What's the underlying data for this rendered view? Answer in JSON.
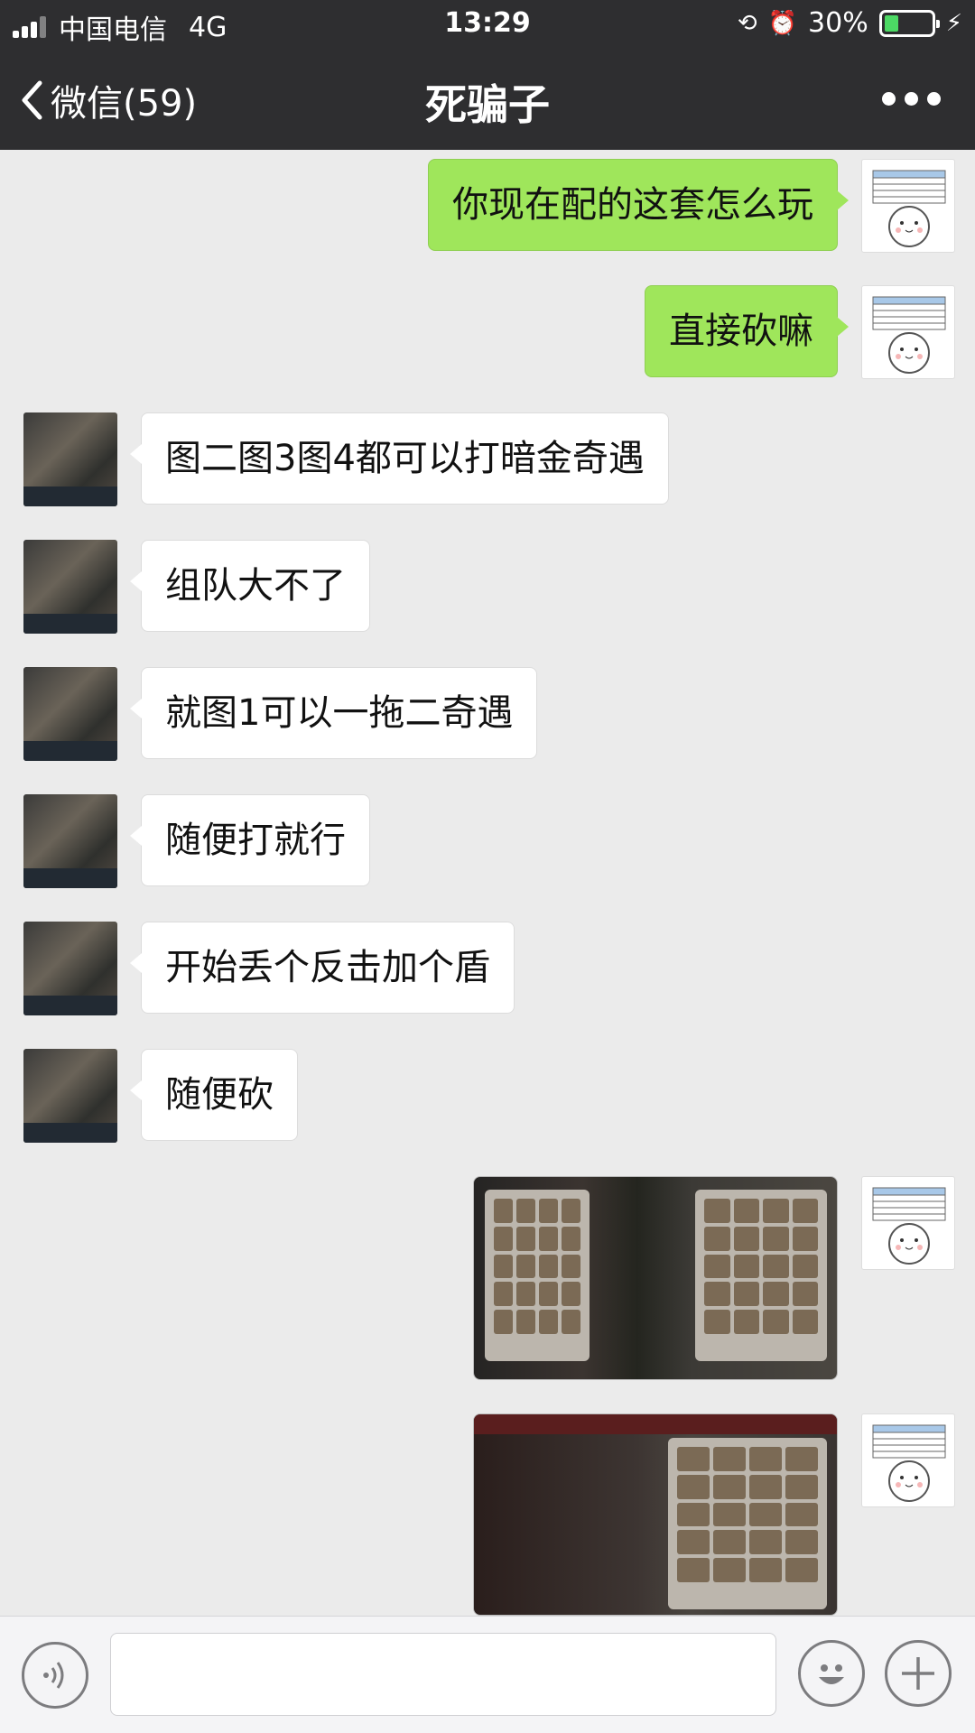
{
  "status_bar": {
    "carrier": "中国电信",
    "network": "4G",
    "time": "13:29",
    "battery_percent": "30%",
    "battery_level": 0.3
  },
  "nav": {
    "back_label": "微信(59)",
    "title": "死骗子"
  },
  "messages": [
    {
      "side": "out",
      "text": "你现在配的这套怎么玩"
    },
    {
      "side": "out",
      "text": "直接砍嘛"
    },
    {
      "side": "in",
      "text": "图二图3图4都可以打暗金奇遇"
    },
    {
      "side": "in",
      "text": "组队大不了"
    },
    {
      "side": "in",
      "text": "就图1可以一拖二奇遇"
    },
    {
      "side": "in",
      "text": "随便打就行"
    },
    {
      "side": "in",
      "text": "开始丢个反击加个盾"
    },
    {
      "side": "in",
      "text": "随便砍"
    },
    {
      "side": "out",
      "image": "game-screenshot-1"
    },
    {
      "side": "out",
      "image": "game-screenshot-2"
    }
  ],
  "input_bar": {
    "voice_icon": "voice-icon",
    "emoji_icon": "emoji-icon",
    "plus_icon": "plus-icon"
  },
  "colors": {
    "nav_bg": "#2e2e30",
    "outgoing_bubble": "#9fe65b",
    "incoming_bubble": "#ffffff",
    "chat_bg": "#ebebeb"
  }
}
